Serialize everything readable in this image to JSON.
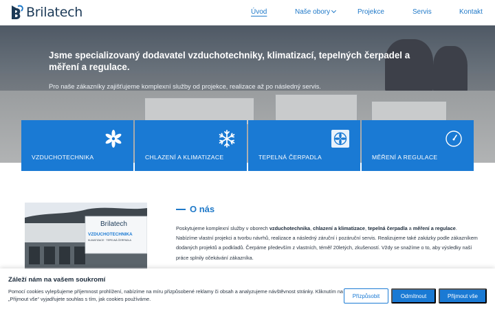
{
  "header": {
    "logo_text": "Brilatech",
    "nav": [
      {
        "label": "Úvod"
      },
      {
        "label": "Naše obory"
      },
      {
        "label": "Projekce"
      },
      {
        "label": "Servis"
      },
      {
        "label": "Kontakt"
      }
    ]
  },
  "hero": {
    "title": "Jsme specializovaný dodavatel vzduchotechniky, klimatizací, tepelných čerpadel a měření a regulace.",
    "subtitle": "Pro naše zákazníky zajišťujeme komplexní služby od projekce, realizace až po následný servis."
  },
  "tiles": [
    {
      "label": "VZDUCHOTECHNIKA",
      "icon": "fan-icon"
    },
    {
      "label": "CHLAZENÍ A KLIMATIZACE",
      "icon": "snowflake-icon"
    },
    {
      "label": "TEPELNÁ ČERPADLA",
      "icon": "heat-pump-icon"
    },
    {
      "label": "MĚŘENÍ A REGULACE",
      "icon": "gauge-icon"
    }
  ],
  "about": {
    "title": "O nás",
    "text_1": "Poskytujeme komplexní služby v oborech ",
    "bold_1": "vzduchotechnika",
    "sep_1": ", ",
    "bold_2": "chlazení a klimatizace",
    "sep_2": ", ",
    "bold_3": "tepelná čerpadla",
    "sep_3": " a ",
    "bold_4": "měření a regulace",
    "text_2": ". Nabízíme vlastní projekci a tvorbu návrhů, realizace a následný záruční i pozáruční servis. Realizujeme také zakázky podle zákazníkem dodaných projektů a podkladů. Čerpáme především z vlastních, téměř 20letých, zkušeností. Vždy se snažíme o to, aby výsledky naší práce splnily očekávání zákazníka."
  },
  "photo_sign": {
    "brand": "Brilatech",
    "line_1": "VZDUCHOTECHNIKA",
    "line_2": "KLIMATIZACE · TEPELNÁ ČERPADLA"
  },
  "cookie": {
    "title": "Záleží nám na vašem soukromí",
    "text": "Pomocí cookies vylepšujeme příjemnost prohlížení, nabízíme na míru přizpůsobené reklamy či obsah a analyzujeme návštěvnost stránky. Kliknutím na „Přijmout vše“ vyjadřujete souhlas s tím, jak cookies používáme.",
    "customize_label": "Přizpůsobit",
    "reject_label": "Odmítnout",
    "accept_label": "Přijmout vše"
  },
  "colors": {
    "accent": "#1a7ad4",
    "nav_text": "#1e78c8",
    "dark_text": "#1b2a3a"
  }
}
